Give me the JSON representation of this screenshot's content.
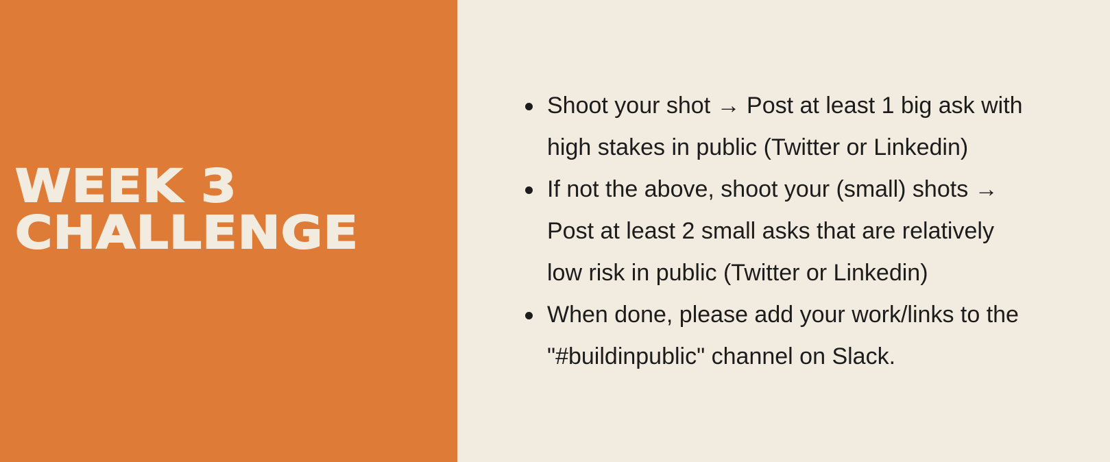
{
  "title": {
    "line1": "WEEK 3",
    "line2": "CHALLENGE"
  },
  "bullets": [
    {
      "line1": "Shoot your shot → Post at least 1 big ask with",
      "line2": "high stakes in public (Twitter or Linkedin)"
    },
    {
      "line1": "If not the above, shoot your (small) shots →",
      "line2": "Post at least 2 small asks that are relatively",
      "line3": "low risk in public (Twitter or Linkedin)"
    },
    {
      "line1": "When done, please add your work/links to the",
      "line2": "\"#buildinpublic\" channel on Slack."
    }
  ],
  "colors": {
    "accent": "#de7c37",
    "background": "#f2ebdf",
    "text": "#1c1c1c"
  }
}
